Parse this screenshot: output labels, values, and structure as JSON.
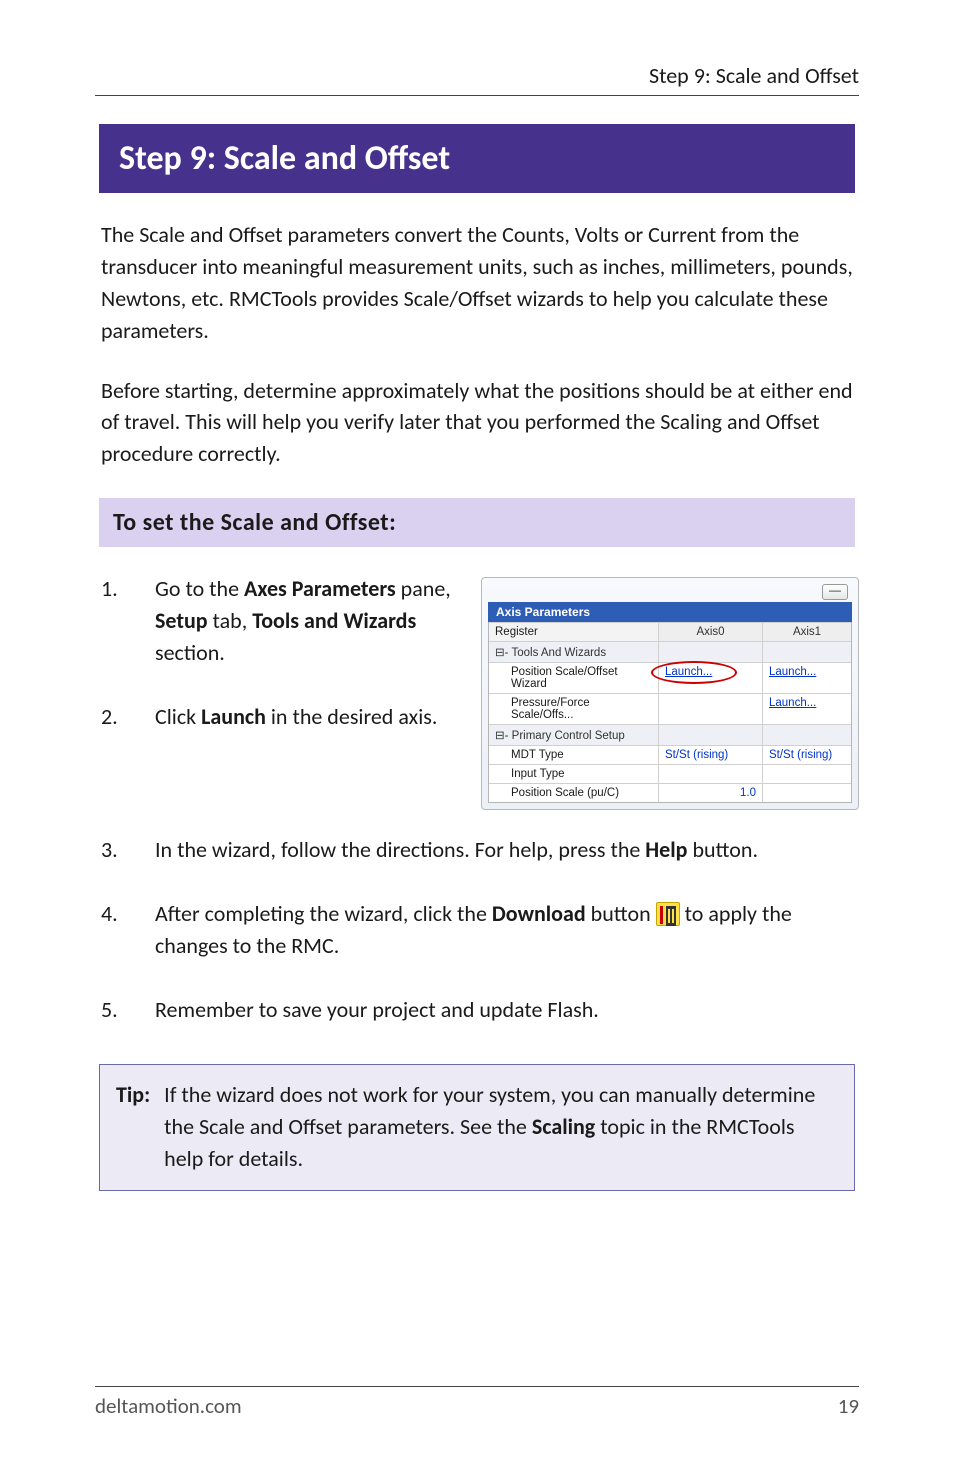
{
  "running_head": "Step 9: Scale and Offset",
  "h1": "Step 9: Scale and Offset",
  "para1_pre": "The Scale and Offset parameters convert the Counts, Volts or Current from the transducer into meaningful measurement units, such as inches, millimeters, pounds, Newtons, etc. RMCTools provides Scale/Offset wizards to help you calculate these parameters.",
  "para2": "Before starting, determine approximately what the positions should be at either end of travel. This will help you verify later that you performed the Scaling and Offset procedure correctly.",
  "h2": "To set the Scale and Offset:",
  "steps": {
    "s1_pre": "Go to the ",
    "s1_b1": "Axes Parameters",
    "s1_mid1": " pane, ",
    "s1_b2": "Setup",
    "s1_mid2": " tab, ",
    "s1_b3": "Tools and Wizards",
    "s1_post": " section.",
    "s2_pre": "Click ",
    "s2_b1": "Launch",
    "s2_post": " in the desired axis.",
    "s3_pre": "In the wizard, follow the directions. For help, press the ",
    "s3_b1": "Help",
    "s3_post": " button.",
    "s4_pre": "After completing the wizard, click the ",
    "s4_b1": "Download",
    "s4_mid": " button ",
    "s4_post": " to apply the changes to the RMC.",
    "s5": "Remember to save your project and update Flash."
  },
  "screenshot": {
    "pane_title": "Axis Parameters",
    "col_register": "Register",
    "col_axis0": "Axis0",
    "col_axis1": "Axis1",
    "sec_tools": "Tools And Wizards",
    "row_pos_wizard": "Position Scale/Offset Wizard",
    "row_pres_wizard": "Pressure/Force Scale/Offs...",
    "launch": "Launch...",
    "sec_primary": "Primary Control Setup",
    "row_mdt": "MDT Type",
    "val_stst": "St/St (rising)",
    "row_input": "Input Type",
    "row_pos_scale": "Position Scale (pu/C)",
    "val_one": "1.0",
    "tree_minus": "⊟-"
  },
  "tip": {
    "label": "Tip:",
    "body_pre": "If the wizard does not work for your system, you can manually determine the Scale and Offset parameters. See the ",
    "body_b": "Scaling",
    "body_post": " topic in the RMCTools help for details."
  },
  "footer_left": "deltamotion.com",
  "footer_right": "19"
}
